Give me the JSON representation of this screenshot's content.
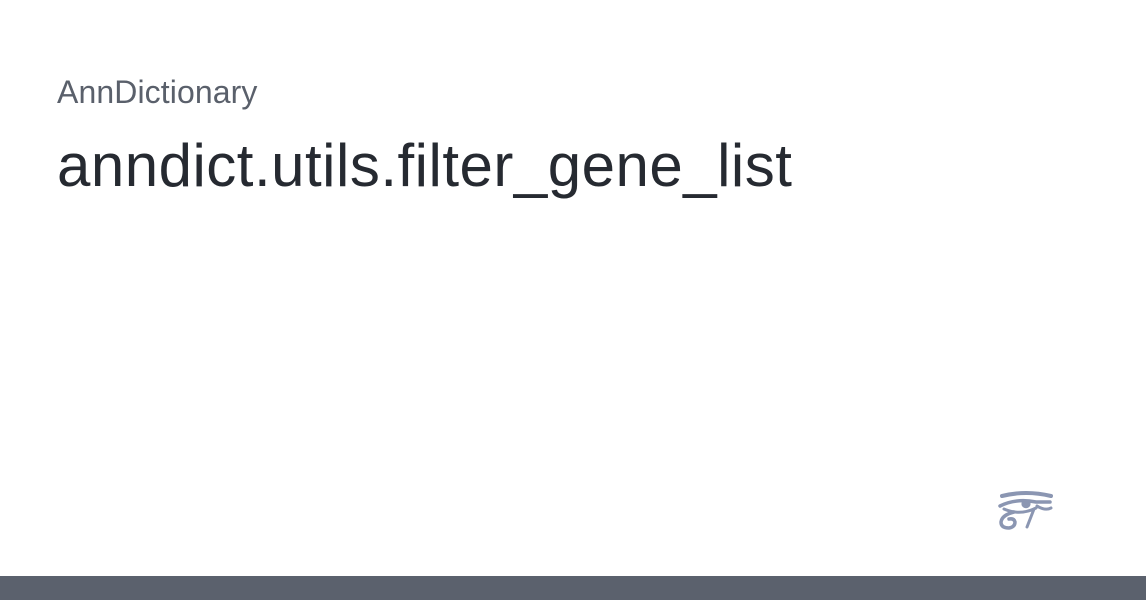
{
  "header": {
    "site_name": "AnnDictionary",
    "page_title": "anndict.utils.filter_gene_list"
  },
  "logo": {
    "icon": "eye-of-horus-icon",
    "color": "#8b96b2"
  },
  "footer": {
    "bar_color": "#5b616d"
  },
  "colors": {
    "background": "#ffffff",
    "site_name_text": "#5a606b",
    "title_text": "#262a31"
  }
}
